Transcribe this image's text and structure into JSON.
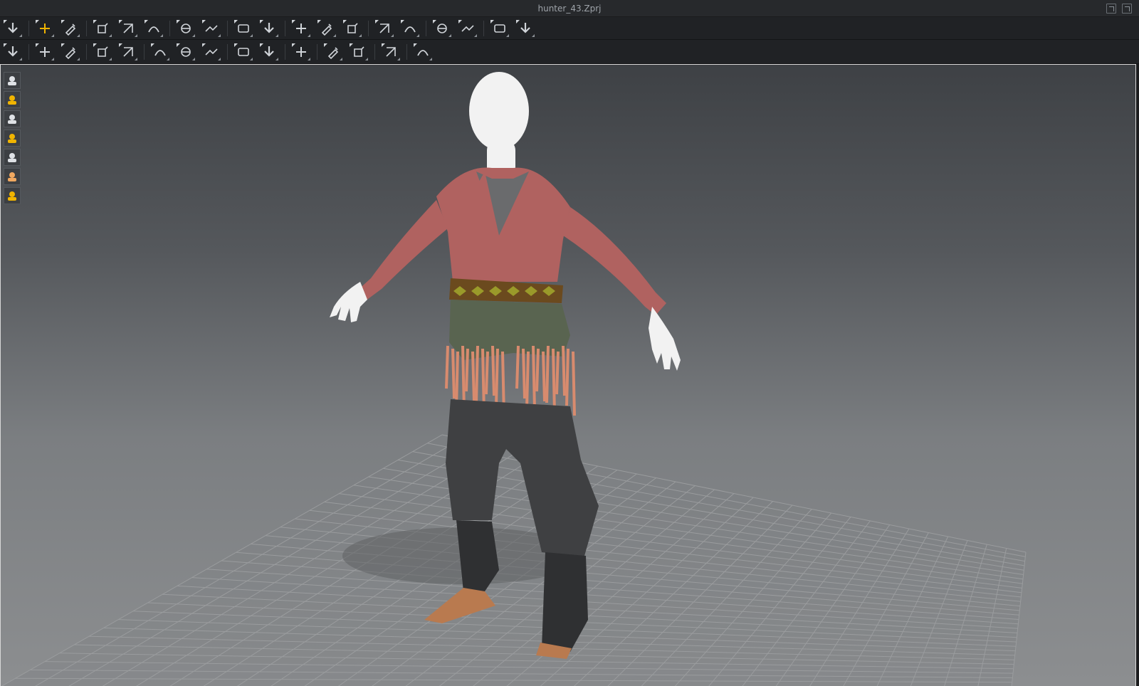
{
  "window": {
    "title": "hunter_43.Zprj"
  },
  "toolbar_row1": {
    "tools": [
      {
        "name": "simulation-icon"
      },
      {
        "name": "transform-move-icon",
        "active": true
      },
      {
        "name": "edit-pattern-icon"
      },
      {
        "name": "rotate-icon"
      },
      {
        "name": "scale-icon"
      },
      {
        "name": "edit-curvature-icon"
      },
      {
        "name": "segment-line-icon"
      },
      {
        "name": "seam-icon"
      },
      {
        "name": "stitch-icon"
      },
      {
        "name": "tack-icon"
      },
      {
        "name": "select-mesh-icon"
      },
      {
        "name": "garment-fit-icon"
      },
      {
        "name": "avatar-hide-icon"
      },
      {
        "name": "layer-up-icon"
      },
      {
        "name": "layer-down-icon"
      },
      {
        "name": "fold-icon"
      },
      {
        "name": "pin-loop-icon"
      },
      {
        "name": "grid-uv-icon"
      },
      {
        "name": "grid-mesh-icon"
      }
    ],
    "colors": {
      "icon": "#cfd3d8",
      "active": "#f0b400"
    }
  },
  "toolbar_row2": {
    "tools": [
      {
        "name": "pose-icon"
      },
      {
        "name": "measure-icon"
      },
      {
        "name": "measure-edit-icon"
      },
      {
        "name": "arrangement-icon"
      },
      {
        "name": "arrangement-edit-icon"
      },
      {
        "name": "fitting-suit-icon"
      },
      {
        "name": "shoe-icon"
      },
      {
        "name": "shirt-fit-icon"
      },
      {
        "name": "button-icon"
      },
      {
        "name": "buttonhole-icon"
      },
      {
        "name": "zipper-icon"
      },
      {
        "name": "strap-icon"
      },
      {
        "name": "topstitch-icon"
      },
      {
        "name": "puckering-icon"
      },
      {
        "name": "snap-icon"
      }
    ]
  },
  "sidebar": {
    "buttons": [
      {
        "name": "show-garment-icon"
      },
      {
        "name": "show-points-icon"
      },
      {
        "name": "show-avatar-icon"
      },
      {
        "name": "texture-icon"
      },
      {
        "name": "render-icon"
      },
      {
        "name": "avatar-skin-icon"
      },
      {
        "name": "environment-icon"
      }
    ]
  },
  "scene": {
    "colors": {
      "shirt": "#b06260",
      "undershirt": "#6a6b6d",
      "sash": "#596450",
      "belt": "#6b4a1e",
      "fringe": "#d88b6e",
      "pants": "#3f4042",
      "boots": "#2f3032",
      "shoe": "#b97a4f",
      "skin": "#f2f2f2",
      "grid": "#9a9c9e"
    }
  }
}
